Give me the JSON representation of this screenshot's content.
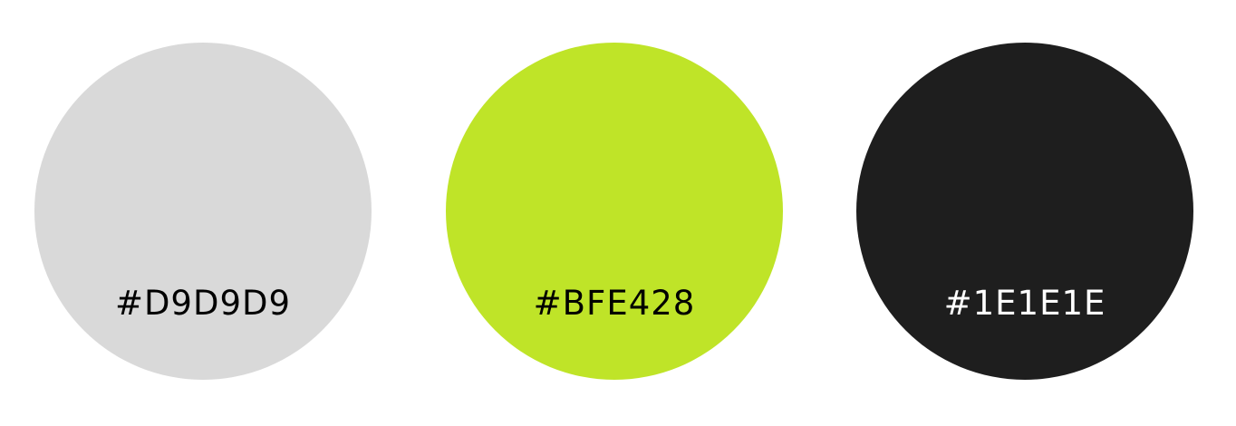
{
  "palette": {
    "swatches": [
      {
        "hex_label": "#D9D9D9",
        "fill": "#D9D9D9",
        "label_color": "#000000"
      },
      {
        "hex_label": "#BFE428",
        "fill": "#BFE428",
        "label_color": "#000000"
      },
      {
        "hex_label": "#1E1E1E",
        "fill": "#1E1E1E",
        "label_color": "#FFFFFF"
      }
    ]
  }
}
